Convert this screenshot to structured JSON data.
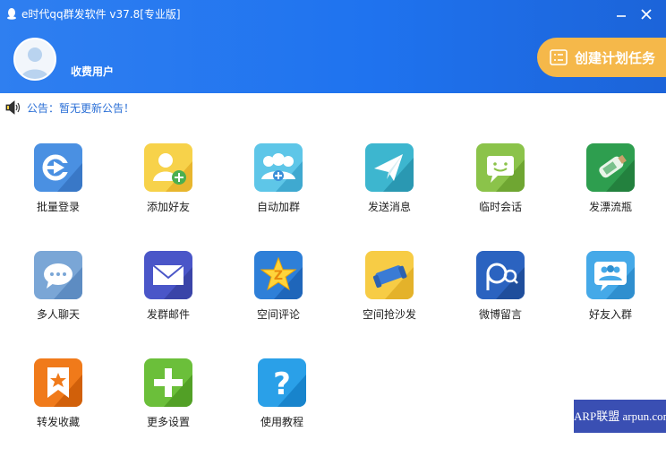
{
  "window": {
    "title": "e时代qq群发软件 v37.8[专业版]"
  },
  "user": {
    "name": "收费用户"
  },
  "header": {
    "create_task_label": "创建计划任务"
  },
  "notice": {
    "text": "公告：暂无更新公告！"
  },
  "tiles": [
    {
      "label": "批量登录",
      "icon": "login-arrow-icon",
      "color": "#4a90e2"
    },
    {
      "label": "添加好友",
      "icon": "add-friend-icon",
      "color": "#f7d24a"
    },
    {
      "label": "自动加群",
      "icon": "join-group-icon",
      "color": "#5ec6e8"
    },
    {
      "label": "发送消息",
      "icon": "paper-plane-icon",
      "color": "#3db6cf"
    },
    {
      "label": "临时会话",
      "icon": "chat-smile-icon",
      "color": "#8bc34a"
    },
    {
      "label": "发漂流瓶",
      "icon": "drift-bottle-icon",
      "color": "#2e9e4f"
    },
    {
      "label": "多人聊天",
      "icon": "group-chat-icon",
      "color": "#7aa6d6"
    },
    {
      "label": "发群邮件",
      "icon": "mail-icon",
      "color": "#4a56c8"
    },
    {
      "label": "空间评论",
      "icon": "qzone-star-icon",
      "color": "#2e7fd8"
    },
    {
      "label": "空间抢沙发",
      "icon": "sofa-icon",
      "color": "#f7cc45"
    },
    {
      "label": "微博留言",
      "icon": "weibo-icon",
      "color": "#2b63c0"
    },
    {
      "label": "好友入群",
      "icon": "friends-group-icon",
      "color": "#45a9e8"
    },
    {
      "label": "转发收藏",
      "icon": "bookmark-icon",
      "color": "#f07a1a"
    },
    {
      "label": "更多设置",
      "icon": "plus-icon",
      "color": "#6bbf3a"
    },
    {
      "label": "使用教程",
      "icon": "help-icon",
      "color": "#2aa0e8"
    }
  ],
  "watermark": {
    "text": "ARP联盟 arpun.com"
  }
}
